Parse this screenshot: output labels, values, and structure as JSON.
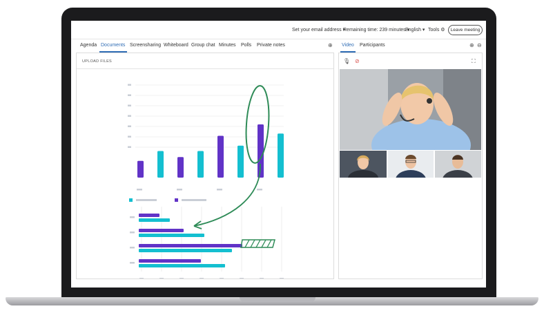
{
  "topbar": {
    "email": "Set your email address ▾",
    "remaining": "Remaining time: 239 minutes ▾",
    "language": "English ▾",
    "tools": "Tools ⚙",
    "leave": "Leave meeting"
  },
  "left_tabs": [
    "Agenda",
    "Documents",
    "Screensharing",
    "Whiteboard",
    "Group chat",
    "Minutes",
    "Polls",
    "Private notes"
  ],
  "active_left_tab": "Documents",
  "right_tabs": [
    "Video",
    "Participants"
  ],
  "active_right_tab": "Video",
  "upload_label": "UPLOAD FILES",
  "icons": {
    "add_left": "plus-circle-icon",
    "zoom_in": "plus-circle-icon",
    "zoom_out": "minus-circle-icon",
    "mic": "microphone-icon",
    "camera_off": "camera-off-icon",
    "fullscreen": "fullscreen-icon"
  },
  "colors": {
    "purple": "#6133c7",
    "teal": "#14bfd0",
    "annotation_green": "#2e8b57",
    "tab_blue": "#2f6db5"
  },
  "chart_data": [
    {
      "type": "bar",
      "title": "",
      "series": [
        {
          "values": [
            22,
            35,
            27,
            35,
            55,
            42,
            70,
            58
          ]
        }
      ]
    },
    {
      "type": "bar",
      "orientation": "horizontal",
      "title": "",
      "series": [
        {
          "values": [
            30,
            65,
            150,
            90
          ]
        },
        {
          "values": [
            45,
            95,
            135,
            125
          ]
        }
      ]
    }
  ]
}
